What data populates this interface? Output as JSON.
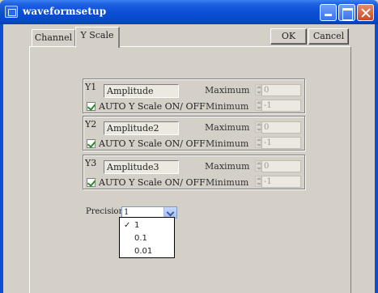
{
  "window": {
    "title": "waveformsetup"
  },
  "tabs": [
    {
      "label": "Channel"
    },
    {
      "label": "Y Scale"
    }
  ],
  "buttons": {
    "ok": "OK",
    "cancel": "Cancel"
  },
  "groups": [
    {
      "label": "Y1",
      "name": "Amplitude",
      "auto_label": "AUTO Y Scale ON/ OFF",
      "auto_checked": true,
      "maximum_label": "Maximum",
      "maximum_value": "0",
      "minimum_label": "Minimum",
      "minimum_value": "-1"
    },
    {
      "label": "Y2",
      "name": "Amplitude2",
      "auto_label": "AUTO Y Scale ON/ OFF",
      "auto_checked": true,
      "maximum_label": "Maximum",
      "maximum_value": "0",
      "minimum_label": "Minimum",
      "minimum_value": "-1"
    },
    {
      "label": "Y3",
      "name": "Amplitude3",
      "auto_label": "AUTO Y Scale ON/ OFF",
      "auto_checked": true,
      "maximum_label": "Maximum",
      "maximum_value": "0",
      "minimum_label": "Minimum",
      "minimum_value": "-1"
    }
  ],
  "precision": {
    "label": "Precision",
    "selected": "1",
    "options": [
      {
        "label": "1",
        "checked": true,
        "check": "✓"
      },
      {
        "label": "0.1"
      },
      {
        "label": "0.01"
      }
    ]
  },
  "colors": {
    "titlebar": "#0a4fd6",
    "background": "#d4d0c8",
    "check": "#2b8a2b"
  }
}
